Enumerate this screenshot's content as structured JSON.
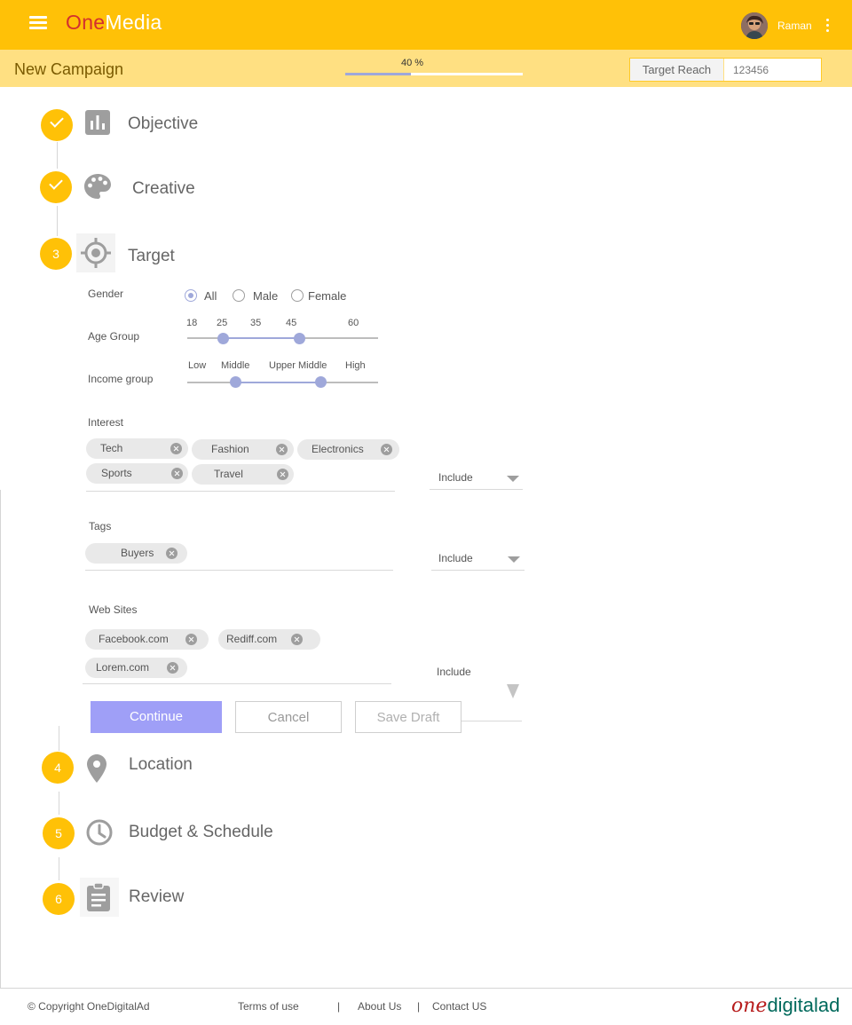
{
  "header": {
    "logo_part1": "One",
    "logo_part2": "Media",
    "user_name": "Raman",
    "icons": [
      "menu-icon",
      "avatar",
      "more-vert-icon"
    ],
    "brand_color": "#ffc107"
  },
  "subheader": {
    "title": "New Campaign",
    "progress_label": "40 %",
    "progress_fraction": 0.37,
    "target_reach_label": "Target Reach",
    "target_reach_value": "123456"
  },
  "steps": [
    {
      "label": "Objective",
      "state": "done",
      "icon": "bar-chart-icon"
    },
    {
      "label": "Creative",
      "state": "done",
      "icon": "palette-icon"
    },
    {
      "label": "Target",
      "state": "active",
      "number": "3",
      "icon": "target-icon"
    },
    {
      "label": "Location",
      "state": "pending",
      "number": "4",
      "icon": "location-pin-icon"
    },
    {
      "label": "Budget & Schedule",
      "state": "pending",
      "number": "5",
      "icon": "clock-icon"
    },
    {
      "label": "Review",
      "state": "pending",
      "number": "6",
      "icon": "clipboard-icon"
    }
  ],
  "target": {
    "gender": {
      "label": "Gender",
      "options": [
        "All",
        "Male",
        "Female"
      ],
      "selected": "All"
    },
    "age": {
      "label": "Age Group",
      "ticks": [
        "18",
        "25",
        "35",
        "45",
        "60"
      ],
      "range": [
        "25",
        "45"
      ]
    },
    "income": {
      "label": "Income  group",
      "ticks": [
        "Low",
        "Middle",
        "Upper Middle",
        "High"
      ],
      "range": [
        "Middle",
        "Upper Middle"
      ]
    },
    "interest": {
      "label": "Interest",
      "chips": [
        "Tech",
        "Fashion",
        "Electronics",
        "Sports",
        "Travel"
      ],
      "mode": "Include"
    },
    "tags": {
      "label": "Tags",
      "chips": [
        "Buyers"
      ],
      "mode": "Include"
    },
    "websites": {
      "label": "Web Sites",
      "chips": [
        "Facebook.com",
        "Rediff.com",
        "Lorem.com"
      ],
      "mode": "Include"
    },
    "buttons": {
      "continue": "Continue",
      "cancel": "Cancel",
      "save_draft": "Save Draft"
    },
    "accent_color": "#9fa8da"
  },
  "footer": {
    "copyright": "© Copyright OneDigitalAd",
    "terms": "Terms of use",
    "separator": "|",
    "about": "About Us",
    "contact": "Contact US",
    "logo_part1": "one",
    "logo_part2": "digitalad"
  }
}
